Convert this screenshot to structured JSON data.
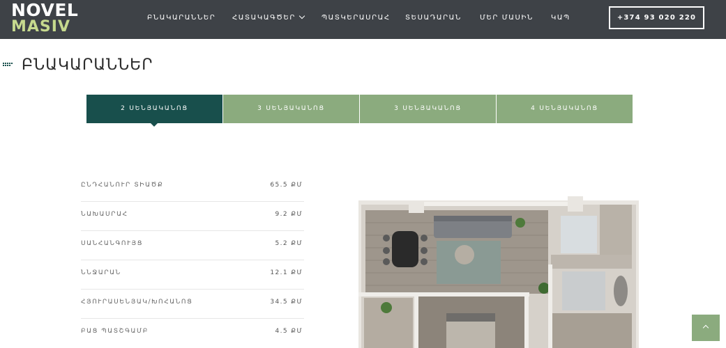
{
  "header": {
    "logo_top": "NOVEL",
    "logo_bottom": "MASIV",
    "nav": [
      {
        "label": "ԲՆԱԿԱՐԱՆՆԵՐ"
      },
      {
        "label": "ՀԱՏԱԿԱԳԾԵՐ"
      },
      {
        "label": "ՊԱՏԿԵՐԱՍՐԱՀ"
      },
      {
        "label": "ՏԵՍԱԴԱՐԱՆ"
      },
      {
        "label": "ՄԵՐ ՄԱՍԻՆ"
      },
      {
        "label": "ԿԱՊ"
      }
    ],
    "phone": "+374 93 020 220"
  },
  "section": {
    "title": "ԲՆԱԿԱՐԱՆՆԵՐ"
  },
  "tabs": [
    {
      "label": "2 ՍԵՆՅԱԿԱՆՈՑ",
      "active": true
    },
    {
      "label": "3 ՍԵՆՅԱԿԱՆՈՑ",
      "active": false
    },
    {
      "label": "3 ՍԵՆՅԱԿԱՆՈՑ",
      "active": false
    },
    {
      "label": "4 ՍԵՆՅԱԿԱՆՈՑ",
      "active": false
    }
  ],
  "specs": [
    {
      "label": "ԸՆԴՀԱՆՈՒՐ ՏԻԱԾՔ",
      "value": "65.5 ՔՄ"
    },
    {
      "label": "ՆԱԽԱՍՐԱՀ",
      "value": "9.2 ՔՄ"
    },
    {
      "label": "ՍԱՆՀԱՆԳՈՒՅՑ",
      "value": "5.2 ՔՄ"
    },
    {
      "label": "ՆՆՋԱՐԱՆ",
      "value": "12.1 ՔՄ"
    },
    {
      "label": "ՀՅՈՒՐԱՍԵՆՅԱԿ/ԽՈՀԱՆՈՑ",
      "value": "34.5 ՔՄ"
    },
    {
      "label": "ԲԱՑ ՊԱՏՇԳԱՄԲ",
      "value": "4.5 ՔՄ"
    }
  ],
  "colors": {
    "header_bg": "#3e4247",
    "logo_accent": "#c6d98e",
    "tab_active": "#184f4c",
    "tab_inactive": "#8bab7e"
  }
}
